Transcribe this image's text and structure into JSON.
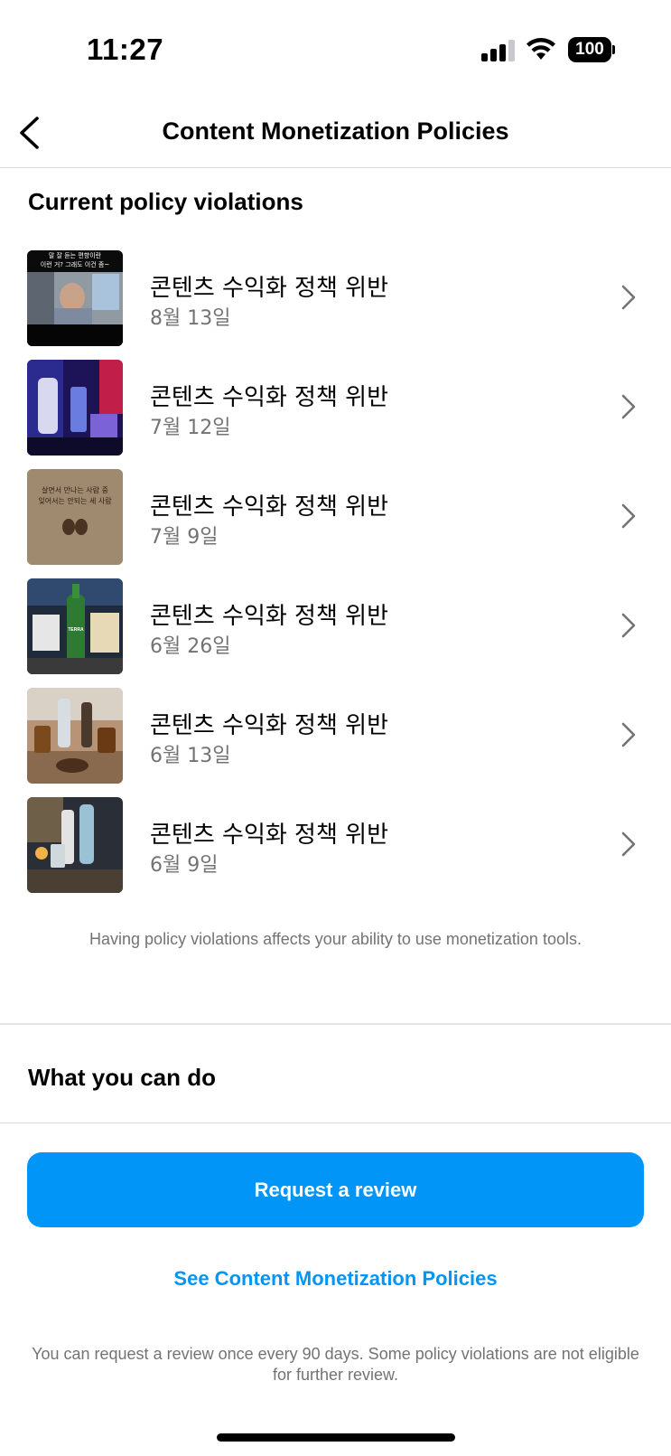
{
  "status_bar": {
    "time": "11:27",
    "battery": "100"
  },
  "header": {
    "title": "Content Monetization Policies"
  },
  "violations_section": {
    "title": "Current policy violations",
    "items": [
      {
        "title": "콘텐츠 수익화 정책 위반",
        "date": "8월 13일",
        "thumb_caption": "말 잘 듣는 편향이란\n이런 거? 그래도 이건 좀~"
      },
      {
        "title": "콘텐츠 수익화 정책 위반",
        "date": "7월 12일"
      },
      {
        "title": "콘텐츠 수익화 정책 위반",
        "date": "7월 9일",
        "thumb_caption": "살면서 만나는 사람 중\n잊어서는 안되는 세 사람"
      },
      {
        "title": "콘텐츠 수익화 정책 위반",
        "date": "6월 26일",
        "thumb_caption": "TERRA"
      },
      {
        "title": "콘텐츠 수익화 정책 위반",
        "date": "6월 13일"
      },
      {
        "title": "콘텐츠 수익화 정책 위반",
        "date": "6월 9일"
      }
    ],
    "notice": "Having policy violations affects your ability to use monetization tools."
  },
  "actions_section": {
    "title": "What you can do",
    "primary_button": "Request a review",
    "link": "See Content Monetization Policies",
    "footnote": "You can request a review once every 90 days. Some policy violations are not eligible for further review."
  },
  "colors": {
    "accent": "#0095f6",
    "secondary_text": "#737373",
    "divider": "#dbdbdb"
  }
}
